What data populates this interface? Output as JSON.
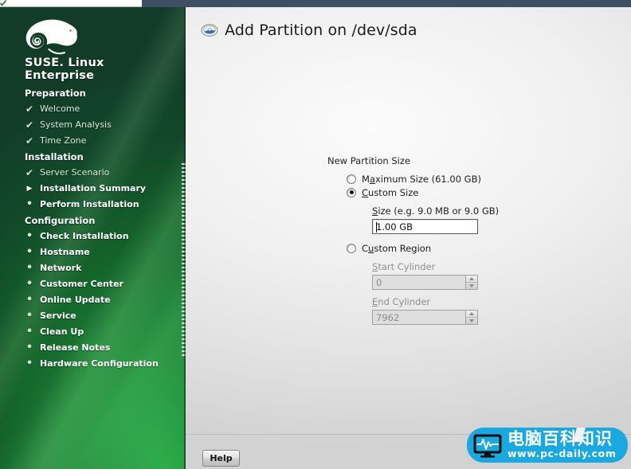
{
  "topbar": {
    "tick_icon": "check-icon"
  },
  "sidebar": {
    "brand_line1": "SUSE. Linux",
    "brand_line2": "Enterprise",
    "logo_icon": "suse-chameleon-logo",
    "groups": [
      {
        "title": "Preparation",
        "items": [
          {
            "label": "Welcome",
            "state": "done",
            "mark": "check-icon"
          },
          {
            "label": "System Analysis",
            "state": "done",
            "mark": "check-icon"
          },
          {
            "label": "Time Zone",
            "state": "done",
            "mark": "check-icon"
          }
        ]
      },
      {
        "title": "Installation",
        "items": [
          {
            "label": "Server Scenario",
            "state": "done",
            "mark": "check-icon"
          },
          {
            "label": "Installation Summary",
            "state": "current",
            "mark": "arrow-right-icon"
          },
          {
            "label": "Perform Installation",
            "state": "todo",
            "mark": "bullet-icon"
          }
        ]
      },
      {
        "title": "Configuration",
        "items": [
          {
            "label": "Check Installation",
            "state": "todo",
            "mark": "bullet-icon"
          },
          {
            "label": "Hostname",
            "state": "todo",
            "mark": "bullet-icon"
          },
          {
            "label": "Network",
            "state": "todo",
            "mark": "bullet-icon"
          },
          {
            "label": "Customer Center",
            "state": "todo",
            "mark": "bullet-icon"
          },
          {
            "label": "Online Update",
            "state": "todo",
            "mark": "bullet-icon"
          },
          {
            "label": "Service",
            "state": "todo",
            "mark": "bullet-icon"
          },
          {
            "label": "Clean Up",
            "state": "todo",
            "mark": "bullet-icon"
          },
          {
            "label": "Release Notes",
            "state": "todo",
            "mark": "bullet-icon"
          },
          {
            "label": "Hardware Configuration",
            "state": "todo",
            "mark": "bullet-icon"
          }
        ]
      }
    ]
  },
  "dialog": {
    "title": "Add Partition on /dev/sda",
    "title_icon": "hard-disk-icon",
    "group_label": "New Partition Size",
    "options": {
      "maximum_size": {
        "label_pre": "M",
        "label_acc": "a",
        "label_post": "ximum Size (61.00 GB)",
        "selected": false
      },
      "custom_size": {
        "label_pre": "",
        "label_acc": "C",
        "label_post": "ustom Size",
        "selected": true
      },
      "custom_region": {
        "label_pre": "C",
        "label_acc": "u",
        "label_post": "stom Region",
        "selected": false
      }
    },
    "size_field": {
      "label_pre": "",
      "label_acc": "S",
      "label_post": "ize (e.g. 9.0 MB or 9.0 GB)",
      "value": "1.00 GB",
      "enabled": true
    },
    "start_cylinder": {
      "label_pre": "",
      "label_acc": "S",
      "label_post": "tart Cylinder",
      "value": "0",
      "enabled": false
    },
    "end_cylinder": {
      "label_pre": "",
      "label_acc": "E",
      "label_post": "nd Cylinder",
      "value": "7962",
      "enabled": false
    }
  },
  "footer": {
    "help_label": "Help"
  },
  "watermark": {
    "cn_text": "电脑百科知识",
    "url_text": "www.pc-daily.com",
    "icon": "monitor-waveform-icon",
    "bg_color": "#19a8e0"
  }
}
